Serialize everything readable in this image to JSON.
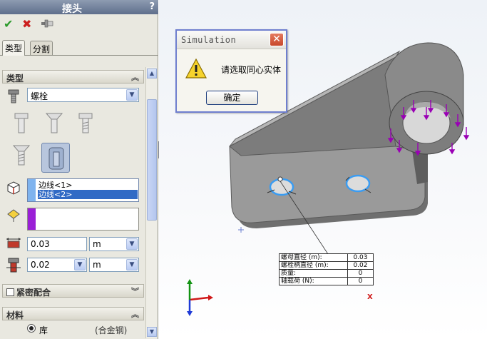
{
  "property_manager": {
    "title": "接头",
    "help": "?",
    "tabs": [
      {
        "label": "类型"
      },
      {
        "label": "分割"
      }
    ],
    "section_type": "类型",
    "fastener_type": "螺栓",
    "edge_list": [
      "边线<1>",
      "边线<2>"
    ],
    "diameter": {
      "value": "0.03",
      "unit": "m"
    },
    "length": {
      "value": "0.02",
      "unit": "m"
    },
    "section_tight_fit": "紧密配合",
    "section_material": "材料",
    "material_option": "库",
    "material_value": "(合金钢)"
  },
  "dialog": {
    "title": "Simulation",
    "close": "✕",
    "message": "请选取同心实体",
    "ok_label": "确定"
  },
  "result_table": [
    {
      "label": "螺母直径 (m):",
      "value": "0.03"
    },
    {
      "label": "螺栓柄直径 (m):",
      "value": "0.02"
    },
    {
      "label": "质量:",
      "value": "0"
    },
    {
      "label": "轴载荷 (N):",
      "value": "0"
    }
  ],
  "triad": {
    "x": "X",
    "y": "Y"
  },
  "colors": {
    "selection_highlight": "#316ac5",
    "edge_color": "#3a9cf2",
    "face_color": "#9a1fd6",
    "restraint_arrows": "#9a00b5"
  }
}
